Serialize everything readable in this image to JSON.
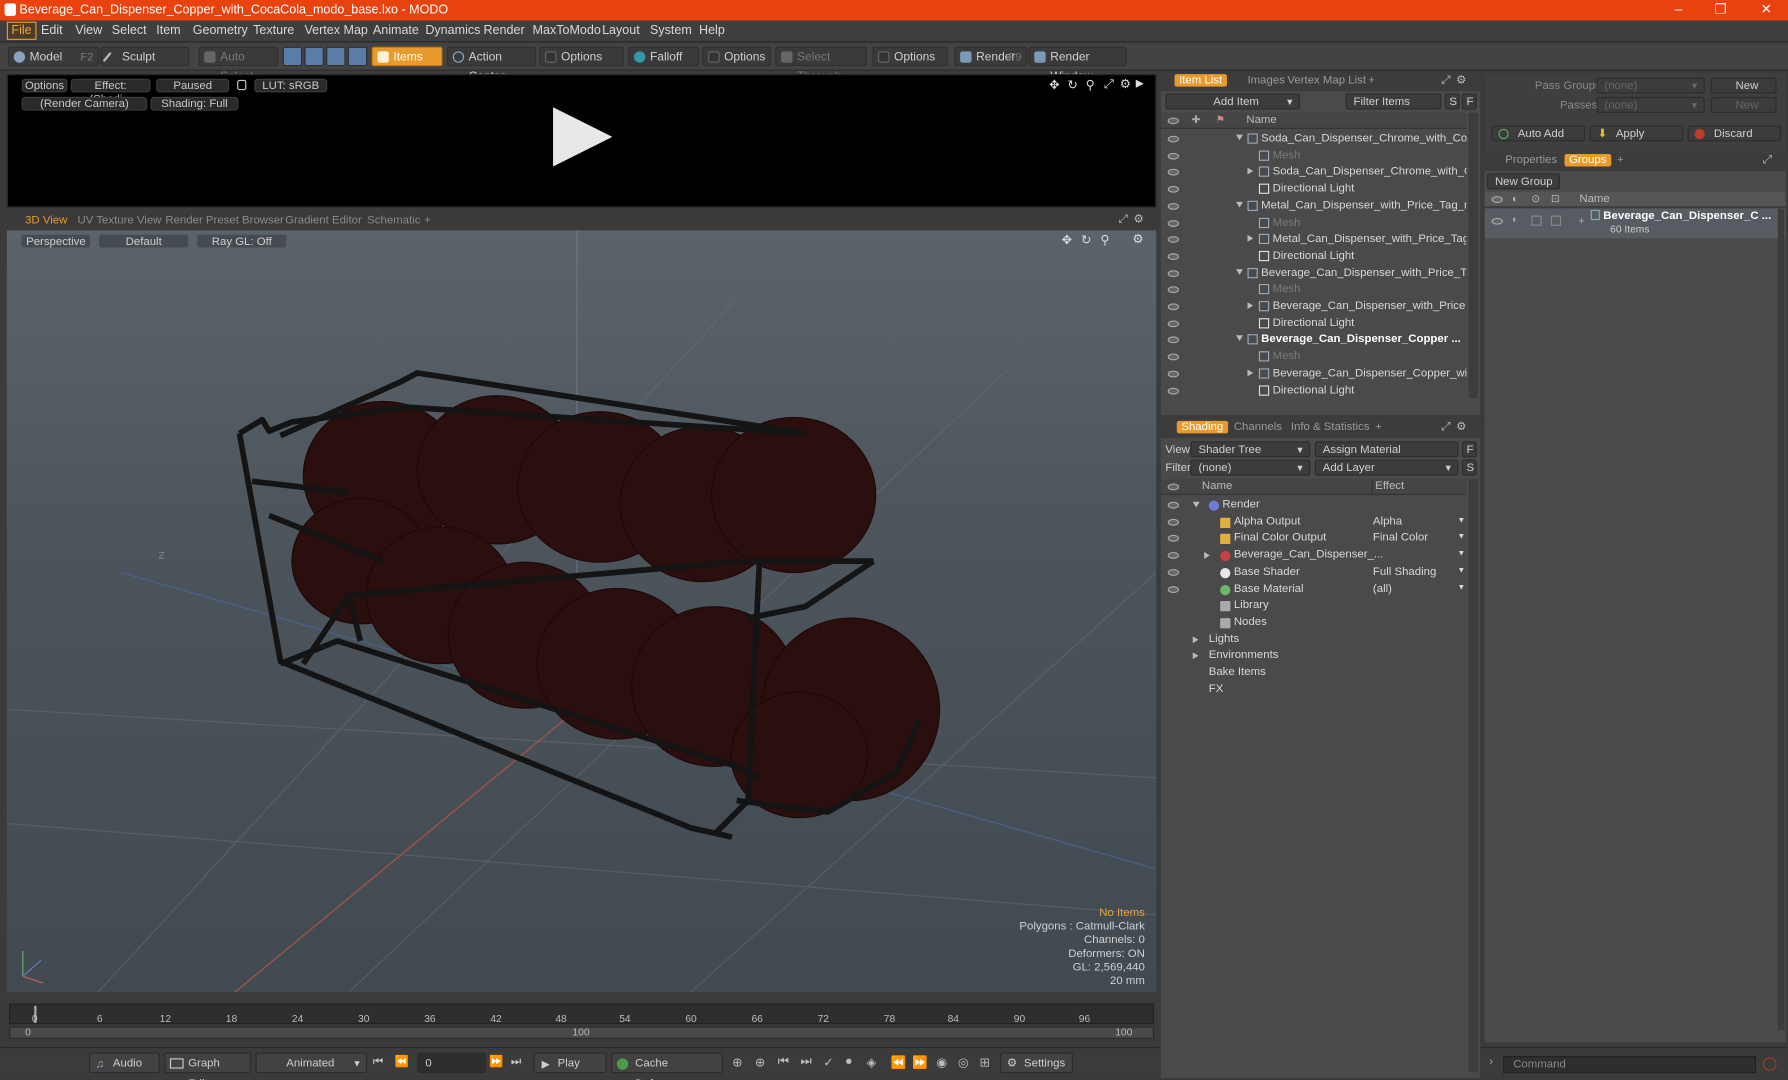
{
  "window": {
    "title": "Beverage_Can_Dispenser_Copper_with_CocaCola_modo_base.lxo - MODO",
    "min": "–",
    "max": "❐",
    "close": "✕"
  },
  "menu": [
    "File",
    "Edit",
    "View",
    "Select",
    "Item",
    "Geometry",
    "Texture",
    "Vertex Map",
    "Animate",
    "Dynamics",
    "Render",
    "MaxToModo",
    "Layout",
    "System",
    "Help"
  ],
  "toolbar": {
    "model": "Model",
    "model_key": "F2",
    "sculpt": "Sculpt",
    "auto_select": "Auto Select",
    "items": "Items",
    "action_center": "Action Center",
    "options1": "Options",
    "falloff": "Falloff",
    "options2": "Options",
    "select_through": "Select Through",
    "options3": "Options",
    "render": "Render",
    "render_key": "F9",
    "render_window": "Render Window"
  },
  "preview": {
    "options": "Options",
    "effect": "Effect: (Shadi...",
    "paused": "Paused",
    "lut": "LUT: sRGB",
    "camera": "(Render Camera)",
    "shading": "Shading: Full"
  },
  "viewport_tabs": [
    "3D View",
    "UV Texture View",
    "Render Preset Browser",
    "Gradient Editor",
    "Schematic",
    "+"
  ],
  "viewport": {
    "perspective": "Perspective",
    "default": "Default",
    "raygl": "Ray GL: Off",
    "axis_z": "Z",
    "info": {
      "no_items": "No Items",
      "polygons": "Polygons : Catmull-Clark",
      "channels": "Channels: 0",
      "deformers": "Deformers: ON",
      "gl": "GL: 2,569,440",
      "scale": "20 mm"
    }
  },
  "timeline": {
    "ticks": [
      "0",
      "6",
      "12",
      "18",
      "24",
      "30",
      "36",
      "42",
      "48",
      "54",
      "60",
      "66",
      "72",
      "78",
      "84",
      "90",
      "96"
    ],
    "range_start": "0",
    "range_mid": "100",
    "range_end": "100"
  },
  "bottom": {
    "audio": "Audio",
    "graph_editor": "Graph Editor",
    "animated": "Animated",
    "frame": "0",
    "play": "Play",
    "cache_deformers": "Cache Deformers",
    "settings": "Settings"
  },
  "itemlist": {
    "tabs": [
      "Item List",
      "Images",
      "Vertex Map List",
      "+"
    ],
    "add_item": "Add Item",
    "filter_items": "Filter Items",
    "s": "S",
    "f": "F",
    "col_name": "Name",
    "rows": [
      {
        "label": "Soda_Can_Dispenser_Chrome_with_Col ...",
        "indent": 0,
        "type": "group",
        "style": ""
      },
      {
        "label": "Mesh",
        "indent": 1,
        "type": "mesh",
        "style": "dim"
      },
      {
        "label": "Soda_Can_Dispenser_Chrome_with_C...",
        "indent": 1,
        "type": "item",
        "style": ""
      },
      {
        "label": "Directional Light",
        "indent": 1,
        "type": "light",
        "style": ""
      },
      {
        "label": "Metal_Can_Dispenser_with_Price_Tag_m...",
        "indent": 0,
        "type": "group",
        "style": ""
      },
      {
        "label": "Mesh",
        "indent": 1,
        "type": "mesh",
        "style": "dim"
      },
      {
        "label": "Metal_Can_Dispenser_with_Price_Tag ...",
        "indent": 1,
        "type": "item",
        "style": ""
      },
      {
        "label": "Directional Light",
        "indent": 1,
        "type": "light",
        "style": ""
      },
      {
        "label": "Beverage_Can_Dispenser_with_Price_Ta...",
        "indent": 0,
        "type": "group",
        "style": ""
      },
      {
        "label": "Mesh",
        "indent": 1,
        "type": "mesh",
        "style": "dim"
      },
      {
        "label": "Beverage_Can_Dispenser_with_Price ...",
        "indent": 1,
        "type": "item",
        "style": ""
      },
      {
        "label": "Directional Light",
        "indent": 1,
        "type": "light",
        "style": ""
      },
      {
        "label": "Beverage_Can_Dispenser_Copper ...",
        "indent": 0,
        "type": "group",
        "style": "bold"
      },
      {
        "label": "Mesh",
        "indent": 1,
        "type": "mesh",
        "style": "dim"
      },
      {
        "label": "Beverage_Can_Dispenser_Copper_wi ...",
        "indent": 1,
        "type": "item",
        "style": ""
      },
      {
        "label": "Directional Light",
        "indent": 1,
        "type": "light",
        "style": ""
      }
    ]
  },
  "shading": {
    "tabs": [
      "Shading",
      "Channels",
      "Info & Statistics",
      "+"
    ],
    "view_label": "View",
    "view_value": "Shader Tree",
    "assign_material": "Assign Material",
    "filter_label": "Filter",
    "filter_value": "(none)",
    "add_layer": "Add Layer",
    "col_name": "Name",
    "col_effect": "Effect",
    "rows": [
      {
        "label": "Render",
        "effect": "",
        "indent": 0
      },
      {
        "label": "Alpha Output",
        "effect": "Alpha",
        "indent": 1
      },
      {
        "label": "Final Color Output",
        "effect": "Final Color",
        "indent": 1
      },
      {
        "label": "Beverage_Can_Dispenser_...",
        "effect": "",
        "indent": 1
      },
      {
        "label": "Base Shader",
        "effect": "Full Shading",
        "indent": 1
      },
      {
        "label": "Base Material",
        "effect": "(all)",
        "indent": 1
      },
      {
        "label": "Library",
        "effect": "",
        "indent": 1
      },
      {
        "label": "Nodes",
        "effect": "",
        "indent": 1
      },
      {
        "label": "Lights",
        "effect": "",
        "indent": 0
      },
      {
        "label": "Environments",
        "effect": "",
        "indent": 0
      },
      {
        "label": "Bake Items",
        "effect": "",
        "indent": 0
      },
      {
        "label": "FX",
        "effect": "",
        "indent": 0
      }
    ]
  },
  "right": {
    "pass_groups": "Pass Groups",
    "passes": "Passes",
    "none1": "(none)",
    "none2": "(none)",
    "new1": "New",
    "new2": "New",
    "auto_add": "Auto Add",
    "apply": "Apply",
    "discard": "Discard",
    "tabs": [
      "Properties",
      "Groups",
      "+"
    ],
    "new_group": "New Group",
    "col_name": "Name",
    "group_name": "Beverage_Can_Dispenser_C ...",
    "group_count": "60 Items",
    "command": "Command"
  }
}
